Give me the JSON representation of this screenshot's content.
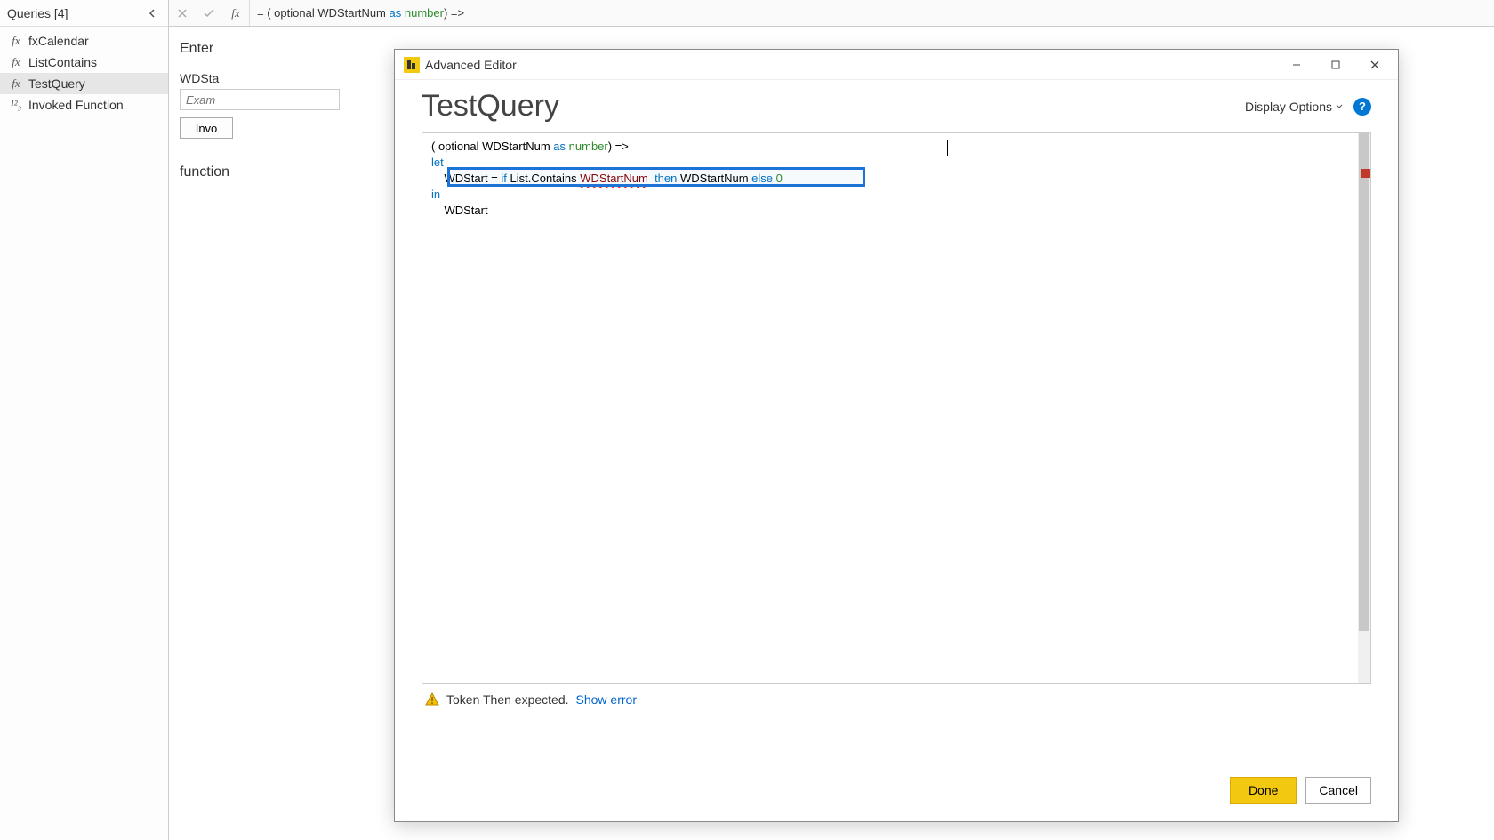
{
  "queries": {
    "header": "Queries [4]",
    "items": [
      {
        "icon": "fx",
        "label": "fxCalendar"
      },
      {
        "icon": "fx",
        "label": "ListContains"
      },
      {
        "icon": "fx",
        "label": "TestQuery"
      },
      {
        "icon": "¹²₃",
        "label": "Invoked Function"
      }
    ]
  },
  "formula_bar": {
    "prefix": "= ",
    "code_plain": "( optional WDStartNum as number) =>",
    "parts": {
      "open": "( ",
      "opt": "optional",
      "name": " WDStartNum ",
      "as": "as",
      "sp": " ",
      "num": "number",
      "close": ") =>"
    }
  },
  "behind_modal": {
    "enter_label": "Enter",
    "param_label": "WDSta",
    "example_placeholder": "Exam",
    "invoke_label": "Invo",
    "function_label": "function"
  },
  "editor": {
    "window_title": "Advanced Editor",
    "heading": "TestQuery",
    "display_options": "Display Options",
    "code": {
      "line1": {
        "open": "( ",
        "opt": "optional",
        "name": " WDStartNum ",
        "as": "as",
        "sp": " ",
        "num": "number",
        "close": ") =>"
      },
      "line2": "let",
      "line3": {
        "indent": "    ",
        "var": "WDStart = ",
        "if": "if",
        "mid1": " List.Contains ",
        "err": "WDStartNum",
        "sp2": "  ",
        "then": "then",
        "mid2": " WDStartNum ",
        "else": "else",
        "sp3": " ",
        "zero": "0"
      },
      "line4": "in",
      "line5": {
        "indent": "    ",
        "val": "WDStart"
      }
    },
    "error_message": "Token Then expected.",
    "show_error": "Show error",
    "done": "Done",
    "cancel": "Cancel"
  }
}
